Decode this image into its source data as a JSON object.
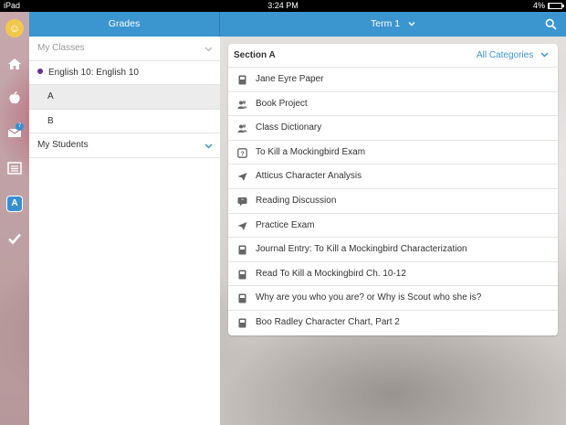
{
  "status_bar": {
    "device": "iPad",
    "time": "3:24 PM",
    "battery_text": "4%",
    "battery_level": 0.04
  },
  "rail": {
    "badge_count": "7",
    "active_icon_letter": "A",
    "icons": [
      "home-icon",
      "apple-icon",
      "mail-icon",
      "list-icon",
      "grades-icon",
      "check-icon"
    ]
  },
  "header": {
    "left_title": "Grades",
    "term_label": "Term 1"
  },
  "left_panel": {
    "my_classes_label": "My Classes",
    "class_name": "English 10: English 10",
    "sections": [
      "A",
      "B"
    ],
    "my_students_label": "My Students"
  },
  "section_card": {
    "title": "Section A",
    "filter_label": "All Categories",
    "assignments": [
      {
        "icon": "book-icon",
        "label": "Jane Eyre Paper"
      },
      {
        "icon": "people-icon",
        "label": "Book Project"
      },
      {
        "icon": "people-icon",
        "label": "Class Dictionary"
      },
      {
        "icon": "quiz-icon",
        "label": "To Kill a Mockingbird Exam"
      },
      {
        "icon": "send-icon",
        "label": "Atticus Character Analysis"
      },
      {
        "icon": "discussion-icon",
        "label": "Reading Discussion"
      },
      {
        "icon": "send-icon",
        "label": "Practice Exam"
      },
      {
        "icon": "book-icon",
        "label": "Journal Entry: To Kill a Mockingbird Characterization"
      },
      {
        "icon": "book-icon",
        "label": "Read To Kill a Mockingbird Ch. 10-12"
      },
      {
        "icon": "book-icon",
        "label": "Why are you who you are? or Why is Scout who she is?"
      },
      {
        "icon": "book-icon",
        "label": "Boo Radley Character Chart, Part 2"
      }
    ]
  },
  "colors": {
    "accent": "#3b95cf",
    "class_dot": "#6a2f8f"
  }
}
